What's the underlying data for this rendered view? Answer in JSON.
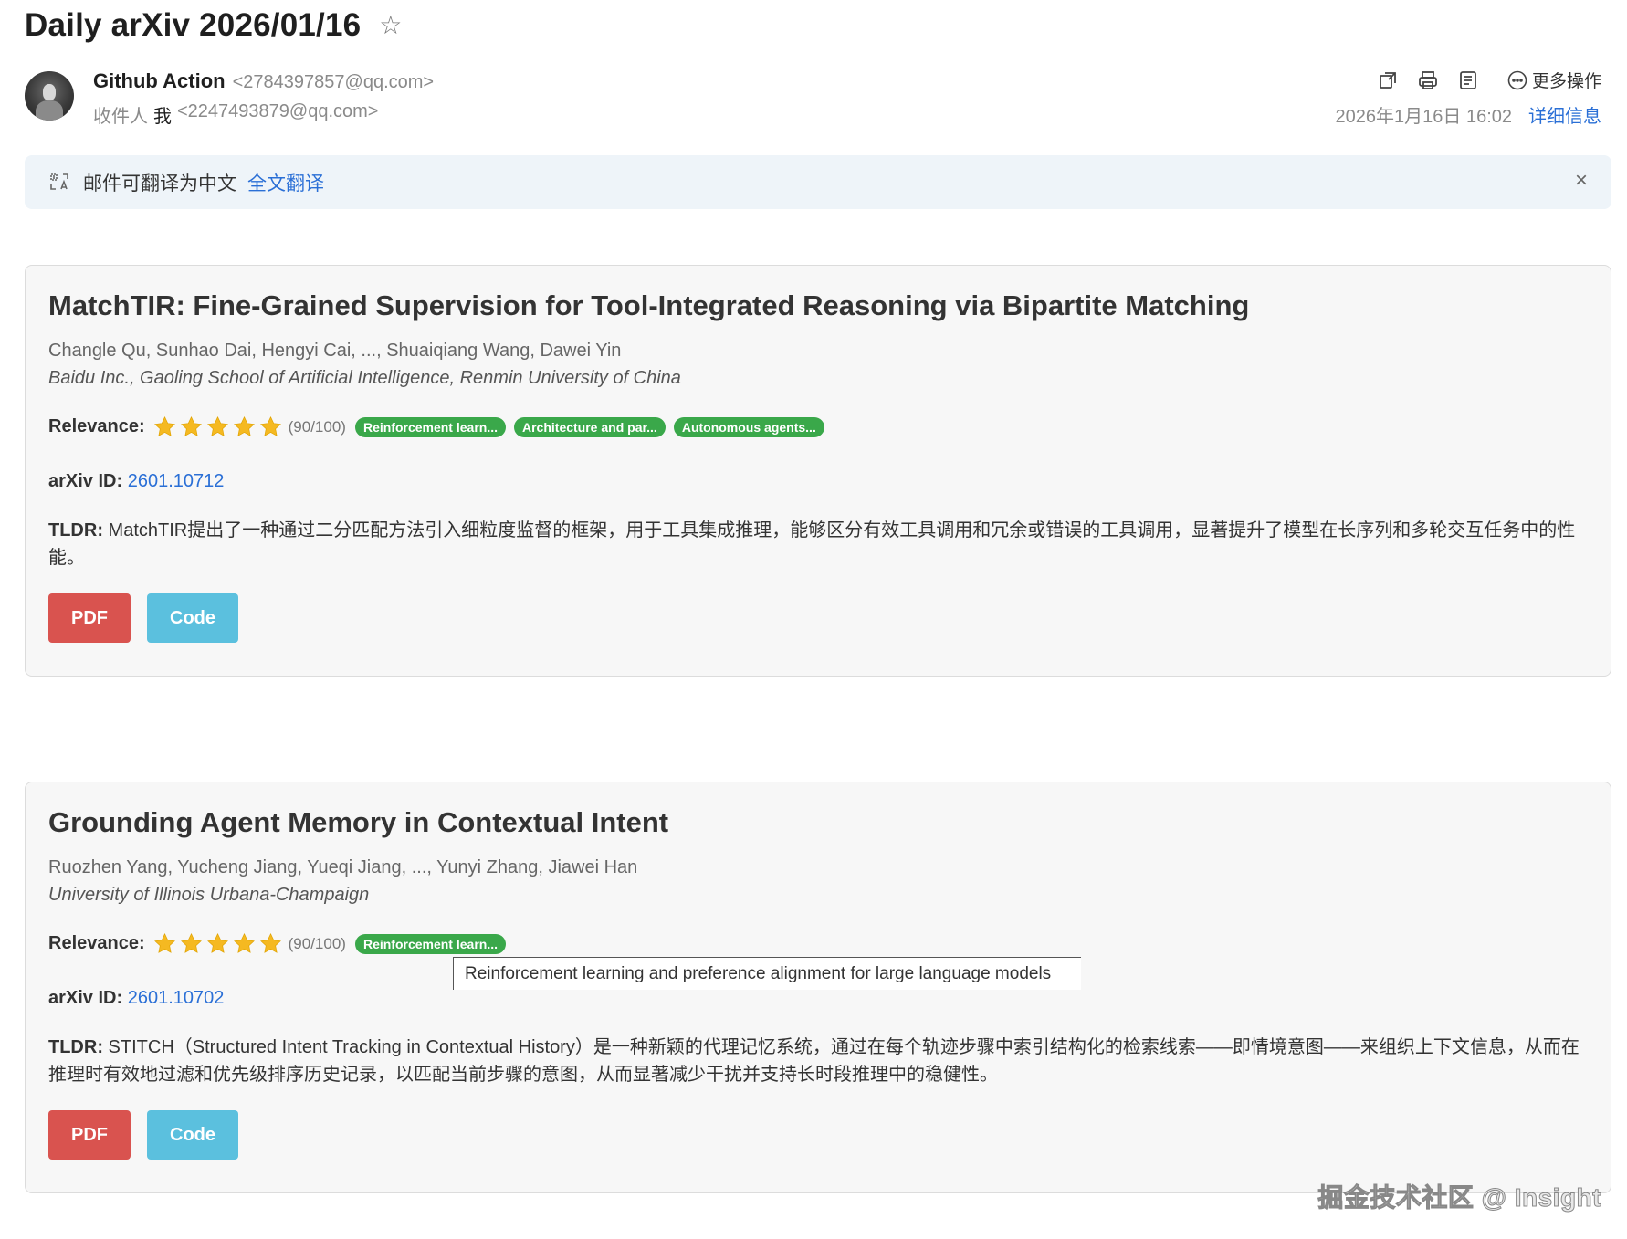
{
  "email": {
    "subject": "Daily arXiv 2026/01/16",
    "sender_name": "Github Action",
    "sender_email": "<2784397857@qq.com>",
    "recipient_label": "收件人",
    "recipient_me": "我",
    "recipient_email": "<2247493879@qq.com>",
    "date": "2026年1月16日 16:02",
    "details_link": "详细信息",
    "more_actions": "更多操作"
  },
  "translate_bar": {
    "text": "邮件可翻译为中文",
    "link": "全文翻译",
    "close": "×"
  },
  "papers": [
    {
      "title": "MatchTIR: Fine-Grained Supervision for Tool-Integrated Reasoning via Bipartite Matching",
      "authors": "Changle Qu, Sunhao Dai, Hengyi Cai, ..., Shuaiqiang Wang, Dawei Yin",
      "affiliation": "Baidu Inc., Gaoling School of Artificial Intelligence, Renmin University of China",
      "relevance_label": "Relevance:",
      "stars": 5,
      "score": "(90/100)",
      "tags": [
        "Reinforcement learn...",
        "Architecture and par...",
        "Autonomous agents..."
      ],
      "arxiv_label": "arXiv ID:",
      "arxiv_id": "2601.10712",
      "tldr_label": "TLDR:",
      "tldr": "MatchTIR提出了一种通过二分匹配方法引入细粒度监督的框架，用于工具集成推理，能够区分有效工具调用和冗余或错误的工具调用，显著提升了模型在长序列和多轮交互任务中的性能。",
      "pdf_label": "PDF",
      "code_label": "Code"
    },
    {
      "title": "Grounding Agent Memory in Contextual Intent",
      "authors": "Ruozhen Yang, Yucheng Jiang, Yueqi Jiang, ..., Yunyi Zhang, Jiawei Han",
      "affiliation": "University of Illinois Urbana-Champaign",
      "relevance_label": "Relevance:",
      "stars": 5,
      "score": "(90/100)",
      "tags": [
        "Reinforcement learn..."
      ],
      "arxiv_label": "arXiv ID:",
      "arxiv_id": "2601.10702",
      "tldr_label": "TLDR:",
      "tldr": "STITCH（Structured Intent Tracking in Contextual History）是一种新颖的代理记忆系统，通过在每个轨迹步骤中索引结构化的检索线索——即情境意图——来组织上下文信息，从而在推理时有效地过滤和优先级排序历史记录，以匹配当前步骤的意图，从而显著减少干扰并支持长时段推理中的稳健性。",
      "pdf_label": "PDF",
      "code_label": "Code"
    }
  ],
  "tooltip": "Reinforcement learning and preference alignment for large language models",
  "watermark": "掘金技术社区 @ Insight",
  "colors": {
    "link": "#2a6fd6",
    "tag": "#3aa84a",
    "pdf_button": "#d9534f",
    "code_button": "#5bc0de",
    "star": "#f5b921"
  }
}
